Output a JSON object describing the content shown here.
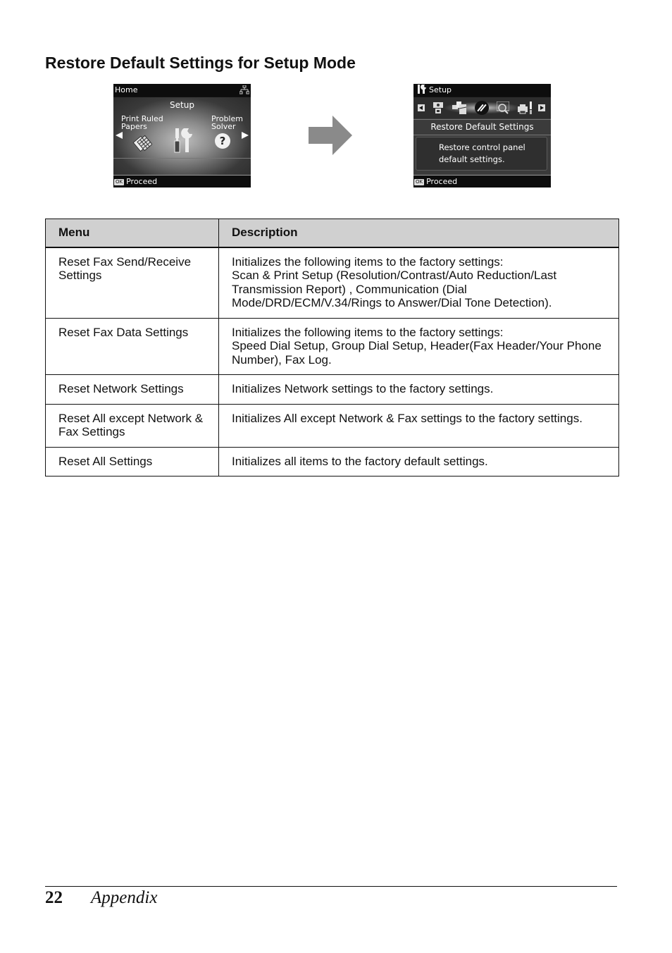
{
  "heading": "Restore Default Settings for Setup Mode",
  "screen_before": {
    "topbar_title": "Home",
    "network_icon": "network-icon",
    "mode_title": "Setup",
    "left_item": [
      "Print Ruled",
      "Papers"
    ],
    "right_item": [
      "Problem",
      "Solver"
    ],
    "left_icon": "ruled-paper-icon",
    "center_icon": "setup-tools-icon",
    "right_icon": "question-icon",
    "right_icon_glyph": "?",
    "ok_key": "OK",
    "ok_action": "Proceed"
  },
  "arrow_icon": "right-arrow-icon",
  "screen_after": {
    "topbar_icon": "setup-tools-icon",
    "topbar_title": "Setup",
    "icons": [
      "left-nav-icon",
      "ink-levels-icon",
      "maintenance-icon",
      "restore-default-icon",
      "nozzle-check-icon",
      "printer-setup-icon",
      "right-nav-icon"
    ],
    "selected_icon": "restore-default-icon",
    "item_title": "Restore Default Settings",
    "description": [
      "Restore control panel",
      "default settings."
    ],
    "ok_key": "OK",
    "ok_action": "Proceed"
  },
  "table": {
    "headers": [
      "Menu",
      "Description"
    ],
    "rows": [
      {
        "menu": "Reset Fax Send/Receive Settings",
        "description": [
          "Initializes the following items to the factory settings:",
          "Scan & Print Setup (Resolution/Contrast/Auto Reduction/Last Transmission Report) , Communication (Dial Mode/DRD/ECM/V.34/Rings to Answer/Dial Tone Detection)."
        ]
      },
      {
        "menu": "Reset Fax Data Settings",
        "description": [
          "Initializes the following items to the factory settings:",
          "Speed Dial Setup, Group Dial Setup, Header(Fax Header/Your Phone Number), Fax Log."
        ]
      },
      {
        "menu": "Reset Network Settings",
        "description": [
          "Initializes Network settings to the factory settings."
        ]
      },
      {
        "menu": "Reset All except Network & Fax Settings",
        "description": [
          "Initializes All except Network & Fax settings to the factory settings."
        ]
      },
      {
        "menu": "Reset All Settings",
        "description": [
          "Initializes all items to the factory default settings."
        ]
      }
    ]
  },
  "footer": {
    "page_number": "22",
    "section": "Appendix"
  }
}
